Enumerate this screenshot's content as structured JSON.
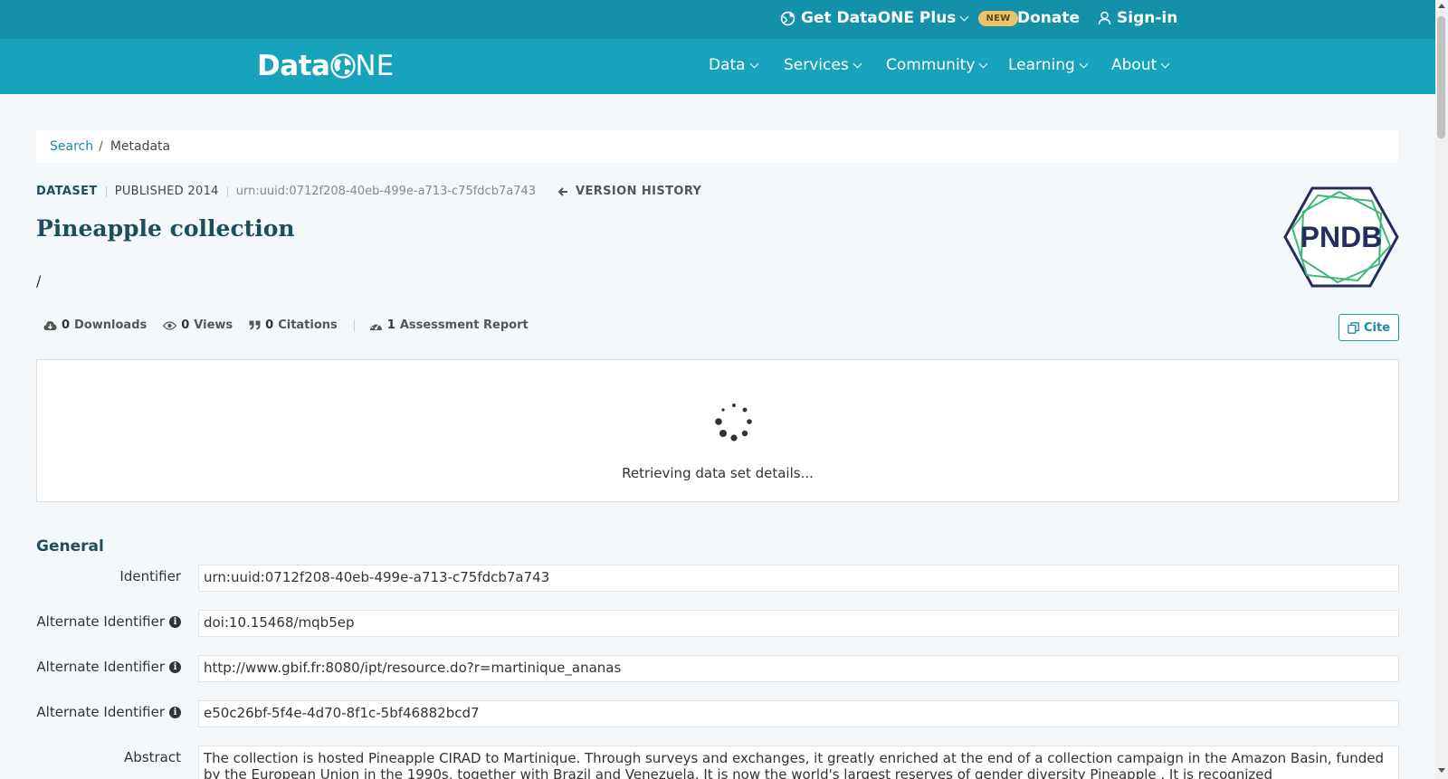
{
  "topbar": {
    "plus_label": "Get DataONE Plus",
    "new_badge": "NEW",
    "donate_label": "Donate",
    "signin_label": "Sign-in"
  },
  "logo": {
    "data": "Data",
    "one": "ONE"
  },
  "nav": [
    {
      "label": "Data"
    },
    {
      "label": "Services"
    },
    {
      "label": "Community"
    },
    {
      "label": "Learning"
    },
    {
      "label": "About"
    }
  ],
  "breadcrumb": {
    "search": "Search",
    "sep": "/",
    "current": "Metadata"
  },
  "dataset": {
    "type": "DATASET",
    "published": "PUBLISHED 2014",
    "id": "urn:uuid:0712f208-40eb-499e-a713-c75fdcb7a743",
    "version_history": "VERSION HISTORY",
    "title": "Pineapple collection",
    "authors": "/",
    "repo_logo_text": "PNDB"
  },
  "metrics": {
    "downloads_count": "0",
    "downloads_label": "Downloads",
    "views_count": "0",
    "views_label": "Views",
    "citations_count": "0",
    "citations_label": "Citations",
    "assessment_count": "1",
    "assessment_label": "Assessment Report",
    "cite_label": "Cite"
  },
  "loading": {
    "text": "Retrieving data set details..."
  },
  "general": {
    "title": "General",
    "fields": [
      {
        "label": "Identifier",
        "value": "urn:uuid:0712f208-40eb-499e-a713-c75fdcb7a743"
      },
      {
        "label": "Alternate Identifier",
        "value": "doi:10.15468/mqb5ep"
      },
      {
        "label": "Alternate Identifier",
        "value": "http://www.gbif.fr:8080/ipt/resource.do?r=martinique_ananas"
      },
      {
        "label": "Alternate Identifier",
        "value": "e50c26bf-5f4e-4d70-8f1c-5bf46882bcd7"
      },
      {
        "label": "Abstract",
        "value": "The collection is hosted Pineapple CIRAD to Martinique. Through surveys and exchanges, it greatly enriched at the end of a collection campaign in the Amazon Basin, funded by the European Union in the 1990s, together with Brazil and Venezuela. It is now the world's largest reserves of gender diversity Pineapple . It is recognized"
      }
    ]
  },
  "colors": {
    "topbar": "#1391a8",
    "nav": "#18a3bd",
    "accent": "#1a8aa8",
    "title": "#1b4f5e"
  }
}
